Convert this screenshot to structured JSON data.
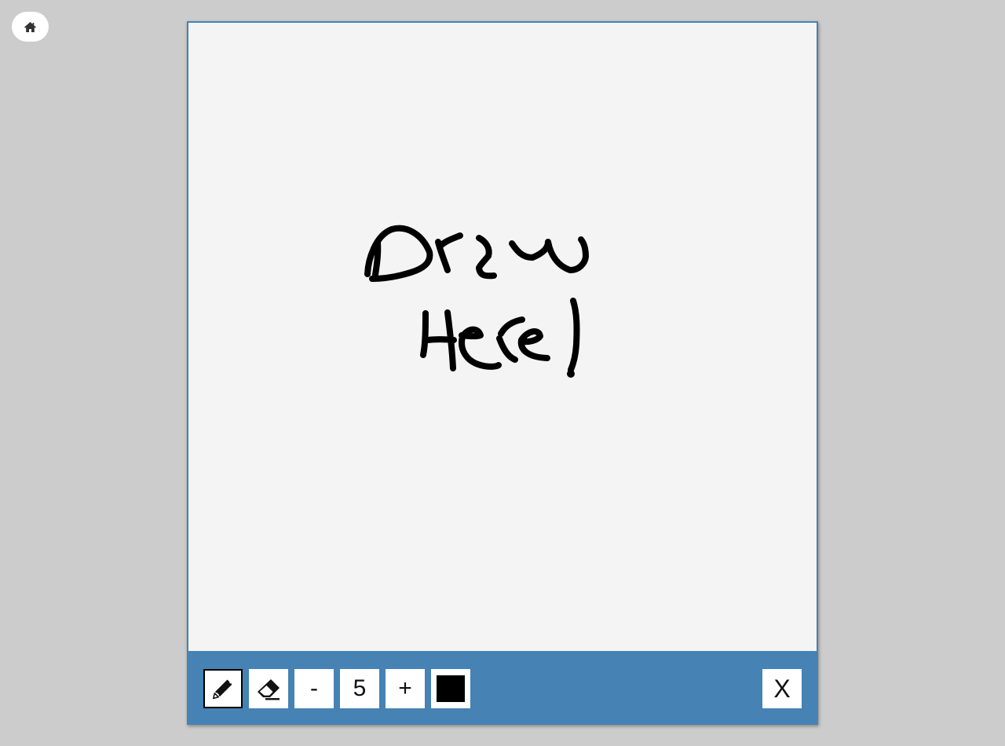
{
  "home": {
    "icon": "home-icon"
  },
  "canvas": {
    "background": "#f4f4f4",
    "drawing_text": "Draw Here!",
    "stroke_color": "#000000"
  },
  "toolbar": {
    "background": "#4682b4",
    "tools": [
      {
        "name": "pencil",
        "icon": "pencil-icon",
        "selected": true
      },
      {
        "name": "eraser",
        "icon": "eraser-icon",
        "selected": false
      }
    ],
    "decrease_label": "-",
    "brush_size": "5",
    "increase_label": "+",
    "current_color": "#000000",
    "close_label": "X"
  }
}
